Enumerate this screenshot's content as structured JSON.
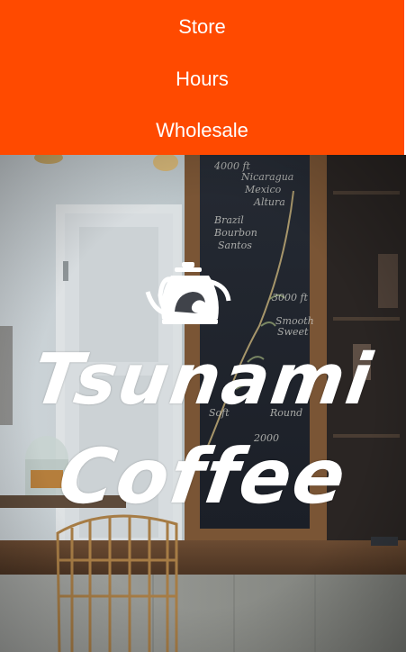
{
  "nav": {
    "items": [
      {
        "label": "Store"
      },
      {
        "label": "Hours"
      },
      {
        "label": "Wholesale"
      }
    ]
  },
  "hero": {
    "brand_line1": "Tsunami",
    "brand_line2": "Coffee",
    "chalkboard": {
      "lines": [
        "4000",
        "Nicaragua",
        "Mexico",
        "Altura",
        "Brazil",
        "Bourbon",
        "Santos",
        "3000 ft",
        "Smooth",
        "Sweet",
        "2000",
        "Soft",
        "Round"
      ]
    }
  },
  "colors": {
    "nav_bg": "#ff4a00",
    "nav_text": "#ffffff",
    "logo": "#ffffff"
  }
}
